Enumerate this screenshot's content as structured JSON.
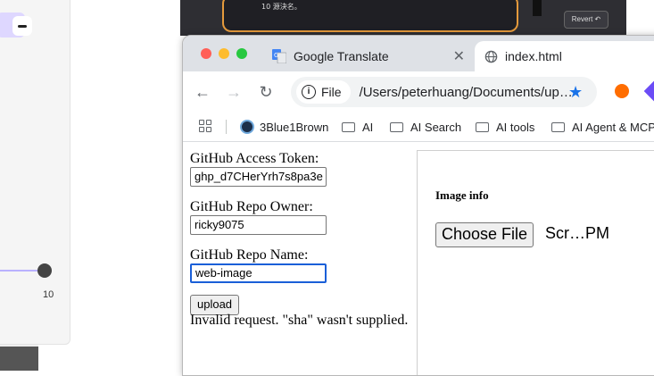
{
  "background": {
    "slider_value": "10",
    "dark_window_text": "10 源決名。",
    "revert_label": "Revert ↶"
  },
  "tabs": [
    {
      "label": "Google Translate",
      "icon": "google-translate-icon",
      "close": "✕"
    },
    {
      "label": "index.html",
      "icon": "globe-icon"
    }
  ],
  "toolbar": {
    "chip_label": "File",
    "url": "/Users/peterhuang/Documents/up…"
  },
  "bookmarks": [
    {
      "label": "3Blue1Brown",
      "icon": "3blue1brown-icon"
    },
    {
      "label": "AI",
      "icon": "folder-icon"
    },
    {
      "label": "AI Search",
      "icon": "folder-icon"
    },
    {
      "label": "AI tools",
      "icon": "folder-icon"
    },
    {
      "label": "AI Agent & MCP",
      "icon": "folder-icon"
    }
  ],
  "form": {
    "token_label": "GitHub Access Token:",
    "token_value": "ghp_d7CHerYrh7s8pa3e",
    "owner_label": "GitHub Repo Owner:",
    "owner_value": "ricky9075",
    "repo_label": "GitHub Repo Name:",
    "repo_value": "web-image",
    "upload_label": "upload",
    "error_message": "Invalid request. \"sha\" wasn't supplied."
  },
  "image_panel": {
    "title": "Image info",
    "choose_label": "Choose File",
    "file_name": "Scr…PM"
  },
  "colors": {
    "tab_bar": "#dee1e6",
    "accent": "#1a73e8",
    "focus_border": "#1a5fd8"
  }
}
